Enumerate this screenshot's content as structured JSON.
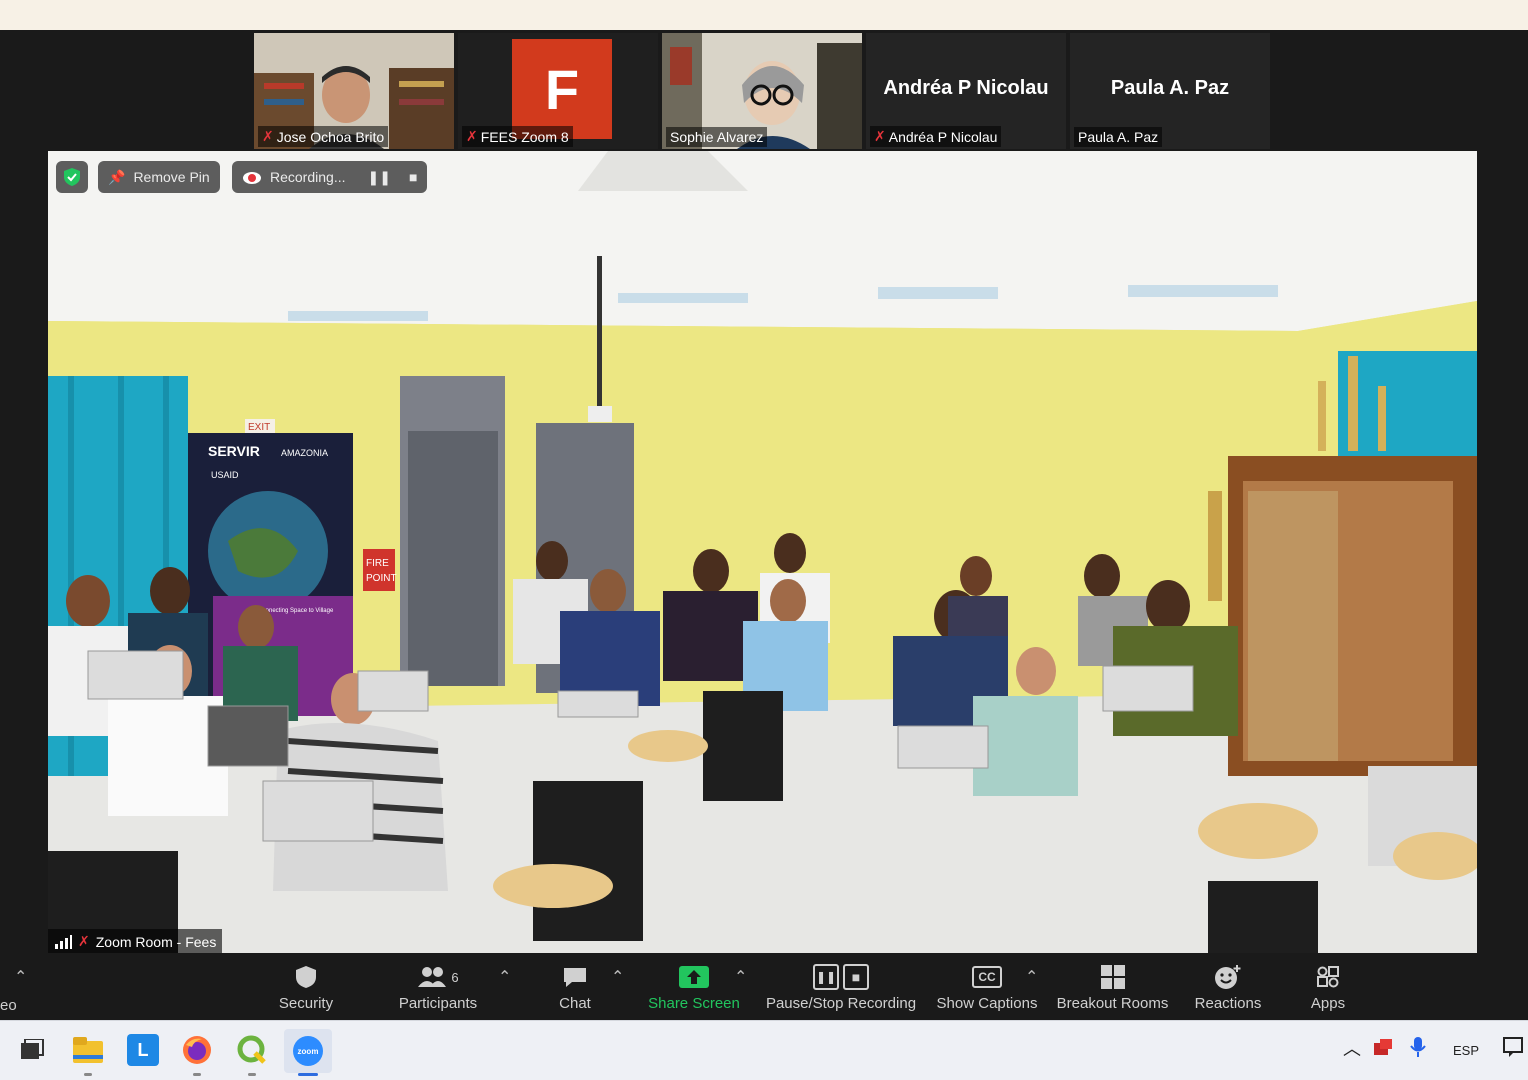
{
  "thumbnails": [
    {
      "name": "Jose Ochoa Brito",
      "muted": true
    },
    {
      "name": "FEES Zoom 8",
      "muted": true,
      "avatar_letter": "F"
    },
    {
      "name": "Sophie Alvarez",
      "muted": false
    },
    {
      "name": "Andréa P Nicolau",
      "muted": true,
      "big_name": "Andréa P Nicolau"
    },
    {
      "name": "Paula A. Paz",
      "muted": false,
      "big_name": "Paula A. Paz"
    }
  ],
  "main": {
    "remove_pin_label": "Remove Pin",
    "recording_label": "Recording...",
    "participant_name": "Zoom Room - Fees",
    "poster": {
      "brand": "SERVIR",
      "brand_sub": "AMAZONIA",
      "logos": "USAID",
      "caption": "Connecting Space to Village"
    },
    "exit_sign": "EXIT",
    "fire_point_line1": "FIRE",
    "fire_point_line2": "POINT"
  },
  "toolbar": {
    "left_partial": "eo",
    "security": "Security",
    "participants": "Participants",
    "participants_count": "6",
    "chat": "Chat",
    "share_screen": "Share Screen",
    "pause_stop_recording": "Pause/Stop Recording",
    "show_captions": "Show Captions",
    "captions_icon_text": "CC",
    "breakout_rooms": "Breakout Rooms",
    "reactions": "Reactions",
    "apps": "Apps",
    "share_color": "#22c55e"
  },
  "taskbar": {
    "language": "ESP",
    "launcher_letter": "L",
    "zoom_icon_text": "zoom"
  }
}
